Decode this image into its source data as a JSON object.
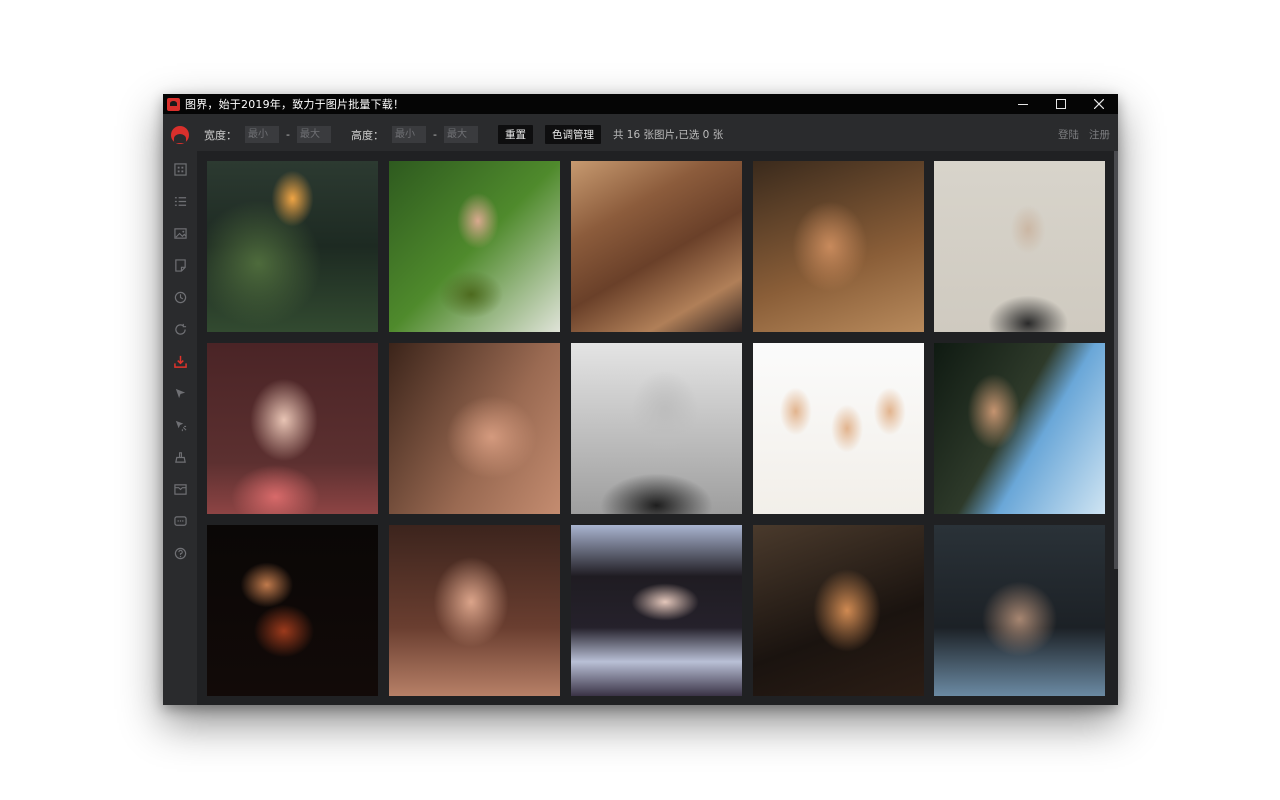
{
  "window": {
    "title": "图界，始于2019年，致力于图片批量下载！"
  },
  "toolbar": {
    "width_label": "宽度：",
    "height_label": "高度：",
    "min_placeholder": "最小",
    "max_placeholder": "最大",
    "dash": "-",
    "reset_label": "重置",
    "color_label": "色调管理",
    "status": "共 16 张图片,已选 0 张",
    "login_label": "登陆",
    "register_label": "注册"
  },
  "sidebar": {
    "items": [
      {
        "icon": "qrcode-icon"
      },
      {
        "icon": "list-icon"
      },
      {
        "icon": "image-icon"
      },
      {
        "icon": "note-icon"
      },
      {
        "icon": "clock-icon"
      },
      {
        "icon": "refresh-icon"
      },
      {
        "icon": "download-icon",
        "active": true
      },
      {
        "icon": "cursor-icon"
      },
      {
        "icon": "magic-cursor-icon"
      },
      {
        "icon": "clean-icon"
      },
      {
        "icon": "mail-icon"
      },
      {
        "icon": "message-icon"
      },
      {
        "icon": "help-icon"
      }
    ],
    "active_color": "#e0332b"
  },
  "gallery": {
    "images": [
      {
        "name": "burning-head-portrait"
      },
      {
        "name": "girl-in-leaves"
      },
      {
        "name": "arm-bracelet"
      },
      {
        "name": "shadow-face"
      },
      {
        "name": "windblown-hair-sketch"
      },
      {
        "name": "hands-on-face"
      },
      {
        "name": "curly-hair-closeup"
      },
      {
        "name": "bw-turtleneck"
      },
      {
        "name": "anime-figures"
      },
      {
        "name": "profile-light"
      },
      {
        "name": "goldfish-bowl"
      },
      {
        "name": "freckled-portrait"
      },
      {
        "name": "water-reflection"
      },
      {
        "name": "golden-hour-portrait"
      },
      {
        "name": "dark-shoulder-portrait"
      }
    ]
  }
}
